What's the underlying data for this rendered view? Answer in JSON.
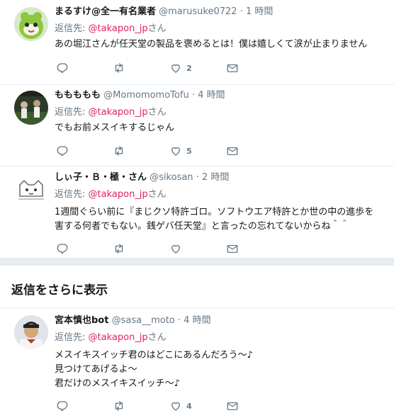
{
  "tweets": [
    {
      "name": "まるすけ@全一有名業者",
      "handle": "@marusuke0722",
      "time": "1 時間",
      "reply_prefix": "返信先:",
      "reply_to": "@takapon_jp",
      "reply_suffix": "さん",
      "lines": [
        "あの堀江さんが任天堂の製品を褒めるとは！僕は嬉しくて涙が止まりません"
      ],
      "like_count": "2"
    },
    {
      "name": "ももももも",
      "handle": "@MomomomoTofu",
      "time": "4 時間",
      "reply_prefix": "返信先:",
      "reply_to": "@takapon_jp",
      "reply_suffix": "さん",
      "lines": [
        "でもお前メスイキするじゃん"
      ],
      "like_count": "5"
    },
    {
      "name": "しぃ子・Ｂ・極・さん",
      "handle": "@sikosan",
      "time": "2 時間",
      "reply_prefix": "返信先:",
      "reply_to": "@takapon_jp",
      "reply_suffix": "さん",
      "lines": [
        "1週間ぐらい前に『まじクソ特許ゴロ。ソフトウエア特許とか世の中の進歩を",
        "害する何者でもない。銭ゲバ任天堂』と言ったの忘れてないからね＾＾"
      ],
      "like_count": ""
    },
    {
      "name": "宮本慎也bot",
      "handle": "@sasa__moto",
      "time": "4 時間",
      "reply_prefix": "返信先:",
      "reply_to": "@takapon_jp",
      "reply_suffix": "さん",
      "lines": [
        "メスイキスイッチ君のはどこにあるんだろう〜♪",
        "見つけてあげるよ〜",
        "君だけのメスイキスイッチ〜♪"
      ],
      "like_count": "4"
    }
  ],
  "dot": "·",
  "show_more": "返信をさらに表示",
  "colors": {
    "link": "#e0245e",
    "muted": "#657786",
    "text": "#14171a"
  },
  "icons": [
    "reply-icon",
    "retweet-icon",
    "like-icon",
    "dm-icon"
  ]
}
